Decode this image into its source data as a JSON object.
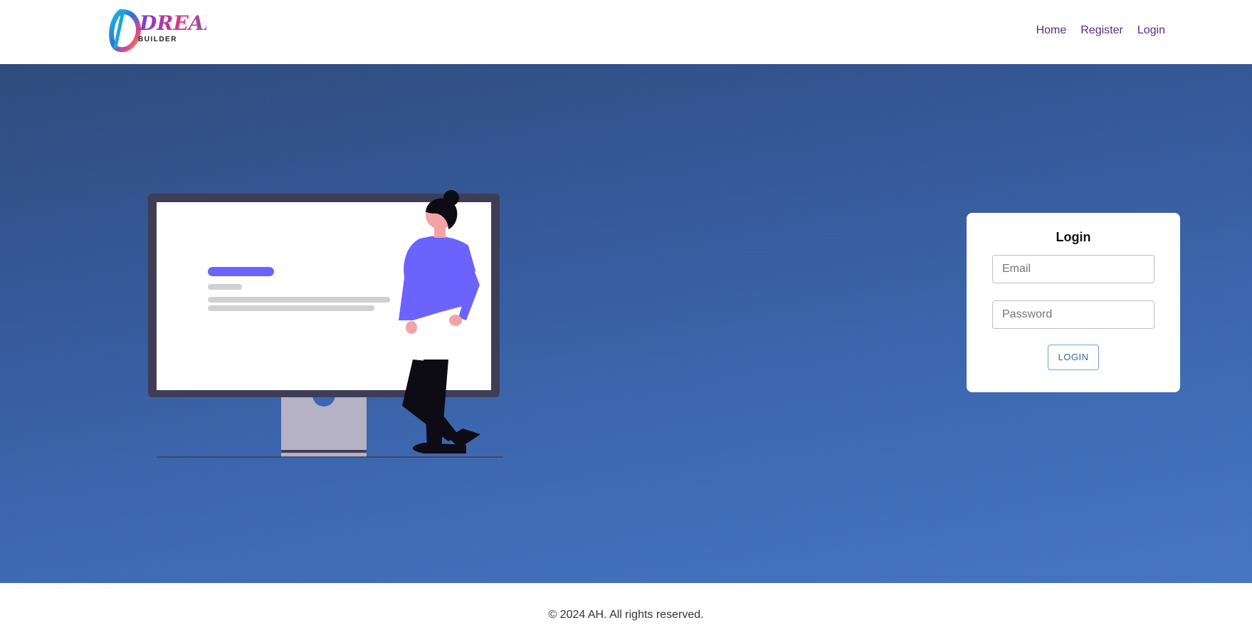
{
  "brand": {
    "logo_text": "DREAM",
    "logo_subtext": "BUILDER"
  },
  "nav": {
    "items": [
      {
        "label": "Home"
      },
      {
        "label": "Register"
      },
      {
        "label": "Login"
      }
    ]
  },
  "login_card": {
    "title": "Login",
    "email_placeholder": "Email",
    "password_placeholder": "Password",
    "submit_label": "LOGIN"
  },
  "footer": {
    "text": "© 2024 AH. All rights reserved."
  },
  "colors": {
    "nav_link": "#5b2a86",
    "hero_gradient_start": "#2d4a7c",
    "hero_gradient_end": "#4674c2",
    "button_text": "#2f6db3",
    "button_border": "#6fa3db"
  }
}
